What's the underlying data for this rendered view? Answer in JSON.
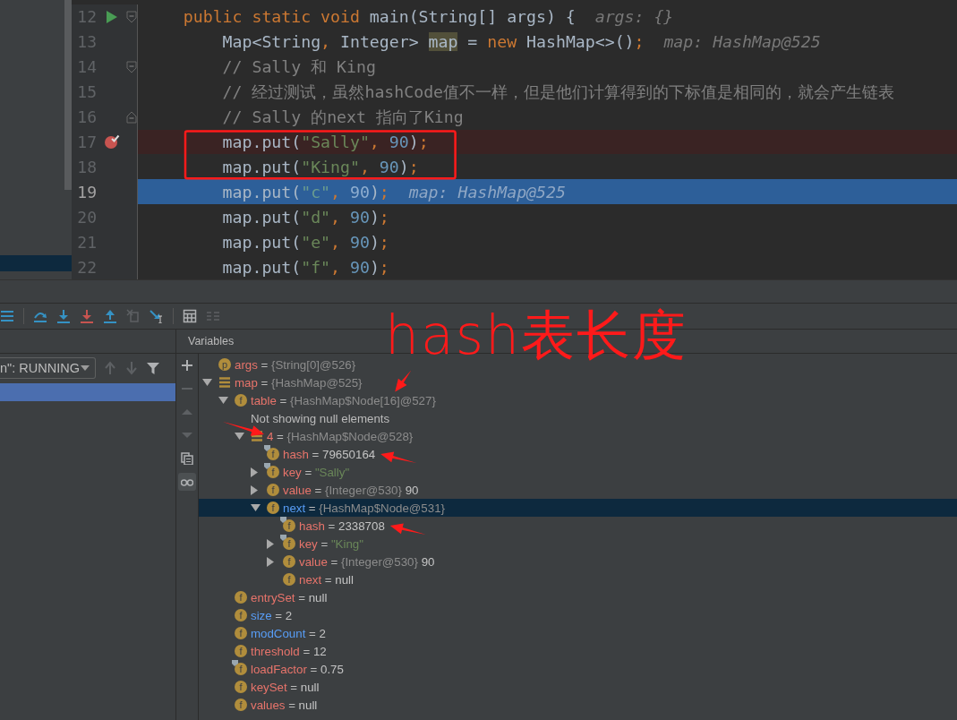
{
  "project_panel": {
    "rows": [
      {
        "selected": true
      }
    ]
  },
  "editor": {
    "lines": [
      {
        "number": "12",
        "kind": "normal",
        "gutter_icon": {
          "kind": "run"
        },
        "fold": {
          "kind": "start"
        },
        "boxed": false,
        "tokens": [
          {
            "kind": "keyword",
            "text": "    public static void "
          },
          {
            "kind": "plain",
            "text": "main(String[] args) {  "
          },
          {
            "kind": "hint",
            "text": "args: {}"
          }
        ]
      },
      {
        "number": "13",
        "kind": "normal",
        "boxed": false,
        "tokens": [
          {
            "kind": "plain",
            "text": "        Map<String"
          },
          {
            "kind": "keyword",
            "text": ","
          },
          {
            "kind": "plain",
            "text": " Integer> "
          },
          {
            "kind": "highlight",
            "text": "map"
          },
          {
            "kind": "plain",
            "text": " = "
          },
          {
            "kind": "keyword",
            "text": "new"
          },
          {
            "kind": "plain",
            "text": " HashMap<>()"
          },
          {
            "kind": "keyword",
            "text": ";  "
          },
          {
            "kind": "hint",
            "text": "map: HashMap@525"
          }
        ]
      },
      {
        "number": "14",
        "kind": "normal",
        "fold": {
          "kind": "start"
        },
        "boxed": false,
        "tokens": [
          {
            "kind": "comment",
            "text": "        // Sally 和 King"
          }
        ]
      },
      {
        "number": "15",
        "kind": "normal",
        "boxed": false,
        "tokens": [
          {
            "kind": "comment",
            "text": "        // 经过测试，虽然hashCode值不一样，但是他们计算得到的下标值是相同的，就会产生链表"
          }
        ]
      },
      {
        "number": "16",
        "kind": "normal",
        "fold": {
          "kind": "end"
        },
        "boxed": false,
        "tokens": [
          {
            "kind": "comment",
            "text": "        // Sally 的next 指向了King"
          }
        ]
      },
      {
        "number": "17",
        "kind": "breakpoint",
        "gutter_icon": {
          "kind": "breakpoint"
        },
        "boxed": true,
        "tokens": [
          {
            "kind": "plain",
            "text": "        map.put("
          },
          {
            "kind": "string",
            "text": "\"Sally\""
          },
          {
            "kind": "keyword",
            "text": ", "
          },
          {
            "kind": "number",
            "text": "90"
          },
          {
            "kind": "plain",
            "text": ")"
          },
          {
            "kind": "keyword",
            "text": ";"
          }
        ]
      },
      {
        "number": "18",
        "kind": "normal",
        "boxed": true,
        "tokens": [
          {
            "kind": "plain",
            "text": "        map.put("
          },
          {
            "kind": "string",
            "text": "\"King\""
          },
          {
            "kind": "keyword",
            "text": ", "
          },
          {
            "kind": "number",
            "text": "90"
          },
          {
            "kind": "plain",
            "text": ")"
          },
          {
            "kind": "keyword",
            "text": ";"
          }
        ]
      },
      {
        "number": "19",
        "kind": "current",
        "boxed": false,
        "tokens": [
          {
            "kind": "plain",
            "text": "        map.put("
          },
          {
            "kind": "string",
            "text": "\"c\""
          },
          {
            "kind": "keyword",
            "text": ", "
          },
          {
            "kind": "number",
            "text": "90"
          },
          {
            "kind": "plain",
            "text": ")"
          },
          {
            "kind": "keyword",
            "text": ";  "
          },
          {
            "kind": "hint",
            "text": "map: HashMap@525"
          }
        ]
      },
      {
        "number": "20",
        "kind": "normal",
        "boxed": false,
        "tokens": [
          {
            "kind": "plain",
            "text": "        map.put("
          },
          {
            "kind": "string",
            "text": "\"d\""
          },
          {
            "kind": "keyword",
            "text": ", "
          },
          {
            "kind": "number",
            "text": "90"
          },
          {
            "kind": "plain",
            "text": ")"
          },
          {
            "kind": "keyword",
            "text": ";"
          }
        ]
      },
      {
        "number": "21",
        "kind": "normal",
        "boxed": false,
        "tokens": [
          {
            "kind": "plain",
            "text": "        map.put("
          },
          {
            "kind": "string",
            "text": "\"e\""
          },
          {
            "kind": "keyword",
            "text": ", "
          },
          {
            "kind": "number",
            "text": "90"
          },
          {
            "kind": "plain",
            "text": ")"
          },
          {
            "kind": "keyword",
            "text": ";"
          }
        ]
      },
      {
        "number": "22",
        "kind": "normal",
        "boxed": false,
        "tokens": [
          {
            "kind": "plain",
            "text": "        map.put("
          },
          {
            "kind": "string",
            "text": "\"f\""
          },
          {
            "kind": "keyword",
            "text": ", "
          },
          {
            "kind": "number",
            "text": "90"
          },
          {
            "kind": "plain",
            "text": ")"
          },
          {
            "kind": "keyword",
            "text": ";"
          }
        ]
      }
    ]
  },
  "debug_toolbar": [
    {
      "kind": "menu",
      "disabled": false
    },
    {
      "kind": "step_over",
      "disabled": false
    },
    {
      "kind": "step_into",
      "disabled": false
    },
    {
      "kind": "force_step_into",
      "disabled": false
    },
    {
      "kind": "step_out",
      "disabled": false
    },
    {
      "kind": "drop_frame",
      "disabled": true
    },
    {
      "kind": "run_to_cursor",
      "disabled": false
    },
    {
      "kind": "evaluate",
      "disabled": false
    },
    {
      "kind": "trace",
      "disabled": true
    }
  ],
  "frames": {
    "thread": "n\": RUNNING",
    "buttons": [
      {
        "kind": "up",
        "disabled": true
      },
      {
        "kind": "down",
        "disabled": true
      },
      {
        "kind": "filter",
        "disabled": false
      }
    ],
    "rows": [
      {
        "selected": true
      }
    ]
  },
  "variables": {
    "title": "Variables",
    "side_buttons": [
      {
        "kind": "add",
        "disabled": false,
        "toggled": false
      },
      {
        "kind": "remove",
        "disabled": true,
        "toggled": false
      },
      {
        "kind": "up",
        "disabled": true,
        "toggled": false
      },
      {
        "kind": "down",
        "disabled": true,
        "toggled": false
      },
      {
        "kind": "copy",
        "disabled": false,
        "toggled": false
      },
      {
        "kind": "glasses",
        "disabled": false,
        "toggled": true
      }
    ],
    "tree": [
      {
        "kind": "var",
        "icon": {
          "kind": "letter",
          "letter": "p"
        },
        "name": "args",
        "sep": "=",
        "ref": "{String[0]@526}",
        "pinned": false,
        "changed": false,
        "selected": false
      },
      {
        "kind": "var",
        "icon": {
          "kind": "list"
        },
        "name": "map",
        "sep": "=",
        "ref": "{HashMap@525}",
        "expanded": true,
        "pinned": false,
        "changed": false,
        "selected": false,
        "children": [
          {
            "kind": "var",
            "icon": {
              "kind": "letter",
              "letter": "f"
            },
            "name": "table",
            "sep": "=",
            "ref": "{HashMap$Node[16]@527}",
            "expanded": true,
            "pinned": false,
            "changed": false,
            "selected": false,
            "arrow": {
              "kind": "above"
            },
            "children": [
              {
                "kind": "message",
                "text": "Not showing null elements",
                "selected": false
              },
              {
                "kind": "var",
                "icon": {
                  "kind": "list"
                },
                "name": "4",
                "sep": "=",
                "ref": "{HashMap$Node@528}",
                "expanded": true,
                "pinned": false,
                "changed": false,
                "selected": false,
                "arrow": {
                  "kind": "left"
                },
                "children": [
                  {
                    "kind": "var",
                    "icon": {
                      "kind": "letter",
                      "letter": "f"
                    },
                    "name": "hash",
                    "sep": "=",
                    "value": {
                      "kind": "plain",
                      "text": "79650164"
                    },
                    "pinned": true,
                    "changed": false,
                    "selected": false,
                    "arrow": {
                      "kind": "right"
                    }
                  },
                  {
                    "kind": "var",
                    "icon": {
                      "kind": "letter",
                      "letter": "f"
                    },
                    "name": "key",
                    "sep": "=",
                    "value": {
                      "kind": "string",
                      "text": "\"Sally\""
                    },
                    "expanded": false,
                    "pinned": true,
                    "changed": false,
                    "selected": false
                  },
                  {
                    "kind": "var",
                    "icon": {
                      "kind": "letter",
                      "letter": "f"
                    },
                    "name": "value",
                    "sep": "=",
                    "ref": "{Integer@530}",
                    "value": {
                      "kind": "plain",
                      "text": "90"
                    },
                    "expanded": false,
                    "pinned": false,
                    "changed": false,
                    "selected": false
                  },
                  {
                    "kind": "var",
                    "icon": {
                      "kind": "letter",
                      "letter": "f"
                    },
                    "name": "next",
                    "sep": "=",
                    "ref": "{HashMap$Node@531}",
                    "expanded": true,
                    "pinned": false,
                    "changed": true,
                    "selected": true,
                    "children": [
                      {
                        "kind": "var",
                        "icon": {
                          "kind": "letter",
                          "letter": "f"
                        },
                        "name": "hash",
                        "sep": "=",
                        "value": {
                          "kind": "plain",
                          "text": "2338708"
                        },
                        "pinned": true,
                        "changed": false,
                        "selected": false,
                        "arrow": {
                          "kind": "right"
                        }
                      },
                      {
                        "kind": "var",
                        "icon": {
                          "kind": "letter",
                          "letter": "f"
                        },
                        "name": "key",
                        "sep": "=",
                        "value": {
                          "kind": "string",
                          "text": "\"King\""
                        },
                        "expanded": false,
                        "pinned": true,
                        "changed": false,
                        "selected": false
                      },
                      {
                        "kind": "var",
                        "icon": {
                          "kind": "letter",
                          "letter": "f"
                        },
                        "name": "value",
                        "sep": "=",
                        "ref": "{Integer@530}",
                        "value": {
                          "kind": "plain",
                          "text": "90"
                        },
                        "expanded": false,
                        "pinned": false,
                        "changed": false,
                        "selected": false
                      },
                      {
                        "kind": "var",
                        "icon": {
                          "kind": "letter",
                          "letter": "f"
                        },
                        "name": "next",
                        "sep": "=",
                        "value": {
                          "kind": "plain",
                          "text": "null"
                        },
                        "pinned": false,
                        "changed": false,
                        "selected": false
                      }
                    ]
                  }
                ]
              }
            ]
          },
          {
            "kind": "var",
            "icon": {
              "kind": "letter",
              "letter": "f"
            },
            "name": "entrySet",
            "sep": "=",
            "value": {
              "kind": "plain",
              "text": "null"
            },
            "pinned": false,
            "changed": false,
            "selected": false
          },
          {
            "kind": "var",
            "icon": {
              "kind": "letter",
              "letter": "f"
            },
            "name": "size",
            "sep": "=",
            "value": {
              "kind": "plain",
              "text": "2"
            },
            "pinned": false,
            "changed": true,
            "selected": false
          },
          {
            "kind": "var",
            "icon": {
              "kind": "letter",
              "letter": "f"
            },
            "name": "modCount",
            "sep": "=",
            "value": {
              "kind": "plain",
              "text": "2"
            },
            "pinned": false,
            "changed": true,
            "selected": false
          },
          {
            "kind": "var",
            "icon": {
              "kind": "letter",
              "letter": "f"
            },
            "name": "threshold",
            "sep": "=",
            "value": {
              "kind": "plain",
              "text": "12"
            },
            "pinned": false,
            "changed": false,
            "selected": false
          },
          {
            "kind": "var",
            "icon": {
              "kind": "letter",
              "letter": "f"
            },
            "name": "loadFactor",
            "sep": "=",
            "value": {
              "kind": "plain",
              "text": "0.75"
            },
            "pinned": true,
            "changed": false,
            "selected": false
          },
          {
            "kind": "var",
            "icon": {
              "kind": "letter",
              "letter": "f"
            },
            "name": "keySet",
            "sep": "=",
            "value": {
              "kind": "plain",
              "text": "null"
            },
            "pinned": false,
            "changed": false,
            "selected": false
          },
          {
            "kind": "var",
            "icon": {
              "kind": "letter",
              "letter": "f"
            },
            "name": "values",
            "sep": "=",
            "value": {
              "kind": "plain",
              "text": "null"
            },
            "pinned": false,
            "changed": false,
            "selected": false
          }
        ]
      }
    ]
  },
  "annotation": {
    "note": "hash表长度"
  }
}
